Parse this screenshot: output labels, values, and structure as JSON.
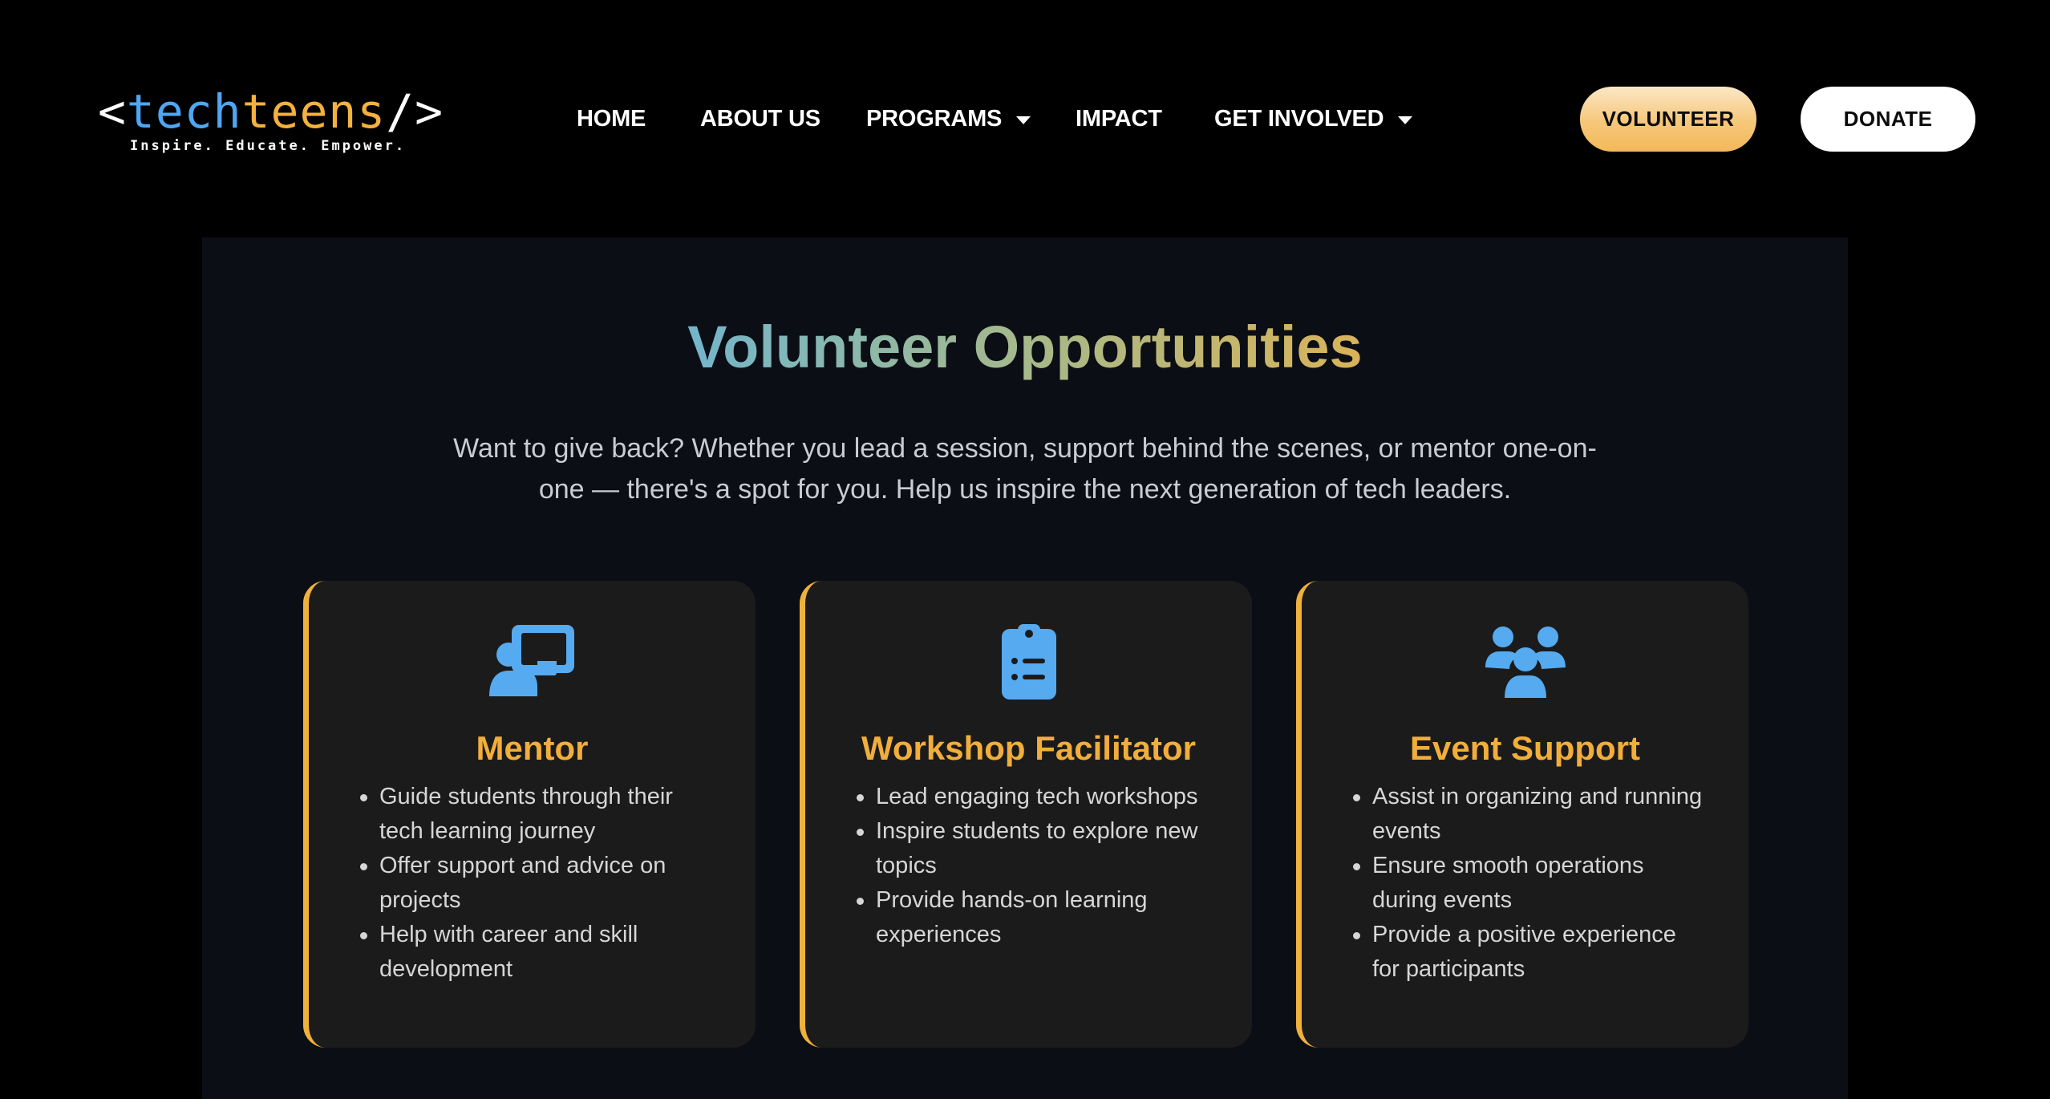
{
  "brand": {
    "logo_open": "<",
    "logo_tech": "tech",
    "logo_teens": "teens",
    "logo_close": "/>",
    "tagline": "Inspire. Educate. Empower."
  },
  "nav": {
    "items": [
      {
        "label": "HOME"
      },
      {
        "label": "ABOUT US"
      },
      {
        "label": "PROGRAMS",
        "dropdown": true
      },
      {
        "label": "IMPACT"
      },
      {
        "label": "GET INVOLVED",
        "dropdown": true
      }
    ]
  },
  "actions": {
    "volunteer": "VOLUNTEER",
    "donate": "DONATE"
  },
  "section": {
    "title": "Volunteer Opportunities",
    "intro": "Want to give back? Whether you lead a session, support behind the scenes, or mentor one-on-one — there's a spot for you. Help us inspire the next generation of tech leaders."
  },
  "cards": [
    {
      "icon": "chalkboard-user-icon",
      "title": "Mentor",
      "points": [
        "Guide students through their tech learning journey",
        "Offer support and advice on projects",
        "Help with career and skill development"
      ]
    },
    {
      "icon": "clipboard-list-icon",
      "title": "Workshop Facilitator",
      "points": [
        "Lead engaging tech workshops",
        "Inspire students to explore new topics",
        "Provide hands-on learning experiences"
      ]
    },
    {
      "icon": "users-group-icon",
      "title": "Event Support",
      "points": [
        "Assist in organizing and running events",
        "Ensure smooth operations during events",
        "Provide a positive experience for participants"
      ]
    }
  ],
  "colors": {
    "accent_orange": "#f2ae3b",
    "icon_blue": "#55aaf0",
    "card_bg": "#1b1b1b",
    "section_bg": "#0b0e15"
  }
}
